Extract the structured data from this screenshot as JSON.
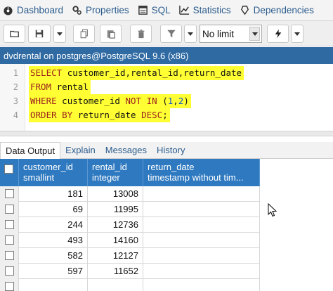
{
  "tabs": [
    {
      "label": "Dashboard",
      "icon": "dashboard-icon"
    },
    {
      "label": "Properties",
      "icon": "properties-icon"
    },
    {
      "label": "SQL",
      "icon": "sql-icon"
    },
    {
      "label": "Statistics",
      "icon": "statistics-icon"
    },
    {
      "label": "Dependencies",
      "icon": "dependencies-icon"
    }
  ],
  "toolbar": {
    "buttons": [
      "open-file-icon",
      "save-icon",
      "copy-icon",
      "paste-icon",
      "delete-icon",
      "filter-icon",
      "execute-icon"
    ],
    "limit_value": "No limit"
  },
  "connection": "dvdrental on postgres@PostgreSQL 9.6 (x86)",
  "editor": {
    "line_numbers": [
      "1",
      "2",
      "3",
      "4"
    ],
    "lines": [
      "SELECT customer_id,rental_id,return_date",
      "FROM rental",
      "WHERE customer_id NOT IN (1,2)",
      "ORDER BY return_date DESC;"
    ]
  },
  "result_tabs": [
    "Data Output",
    "Explain",
    "Messages",
    "History"
  ],
  "grid": {
    "columns": [
      {
        "name": "customer_id",
        "type": "smallint"
      },
      {
        "name": "rental_id",
        "type": "integer"
      },
      {
        "name": "return_date",
        "type": "timestamp without tim..."
      }
    ],
    "rows": [
      {
        "customer_id": "181",
        "rental_id": "13008",
        "return_date": ""
      },
      {
        "customer_id": "69",
        "rental_id": "11995",
        "return_date": ""
      },
      {
        "customer_id": "244",
        "rental_id": "12736",
        "return_date": ""
      },
      {
        "customer_id": "493",
        "rental_id": "14160",
        "return_date": ""
      },
      {
        "customer_id": "582",
        "rental_id": "12127",
        "return_date": ""
      },
      {
        "customer_id": "597",
        "rental_id": "11652",
        "return_date": ""
      },
      {
        "customer_id": "",
        "rental_id": "",
        "return_date": ""
      }
    ]
  },
  "colors": {
    "accent": "#2f6aa3",
    "grid_header": "#2e79c0",
    "highlight": "#ffff33"
  }
}
